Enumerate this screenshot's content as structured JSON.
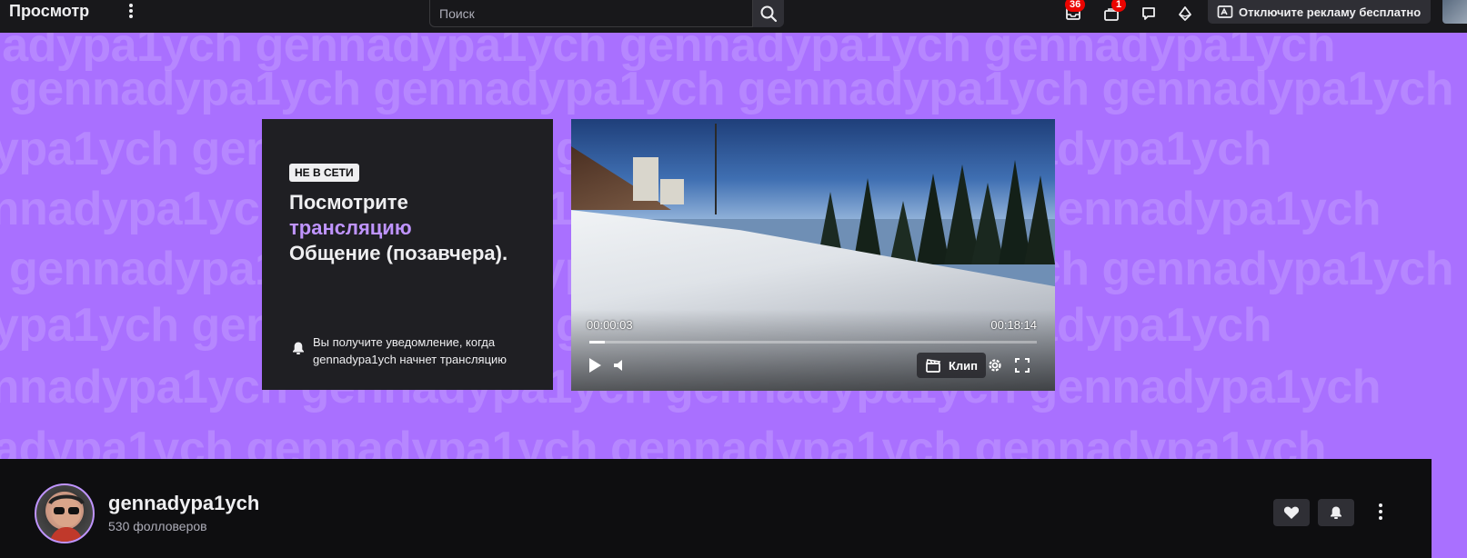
{
  "topbar": {
    "brand": "Просмотр",
    "search_placeholder": "Поиск",
    "icons": [
      {
        "name": "inbox-icon",
        "badge": "36"
      },
      {
        "name": "drops-icon",
        "badge": "1"
      },
      {
        "name": "whispers-icon",
        "badge": ""
      },
      {
        "name": "bits-icon",
        "badge": ""
      }
    ],
    "adfree_label": "Отключите рекламу бесплатно"
  },
  "banner": {
    "watermark": "gennadypa1ych"
  },
  "offline_card": {
    "tag": "НЕ В СЕТИ",
    "title_line1": "Посмотрите",
    "title_accent": "трансляцию",
    "title_line3": "Общение (позавчера).",
    "notify_text": "Вы получите уведомление, когда gennadypa1ych начнет трансляцию"
  },
  "video": {
    "current_time": "00:00:03",
    "duration": "00:18:14",
    "progress": 0.003,
    "clip_label": "Клип"
  },
  "channel": {
    "name": "gennadypa1ych",
    "followers": "530 фолловеров"
  },
  "colors": {
    "accent": "#a970ff",
    "accent_text": "#bf94ff",
    "badge": "#eb0400"
  }
}
